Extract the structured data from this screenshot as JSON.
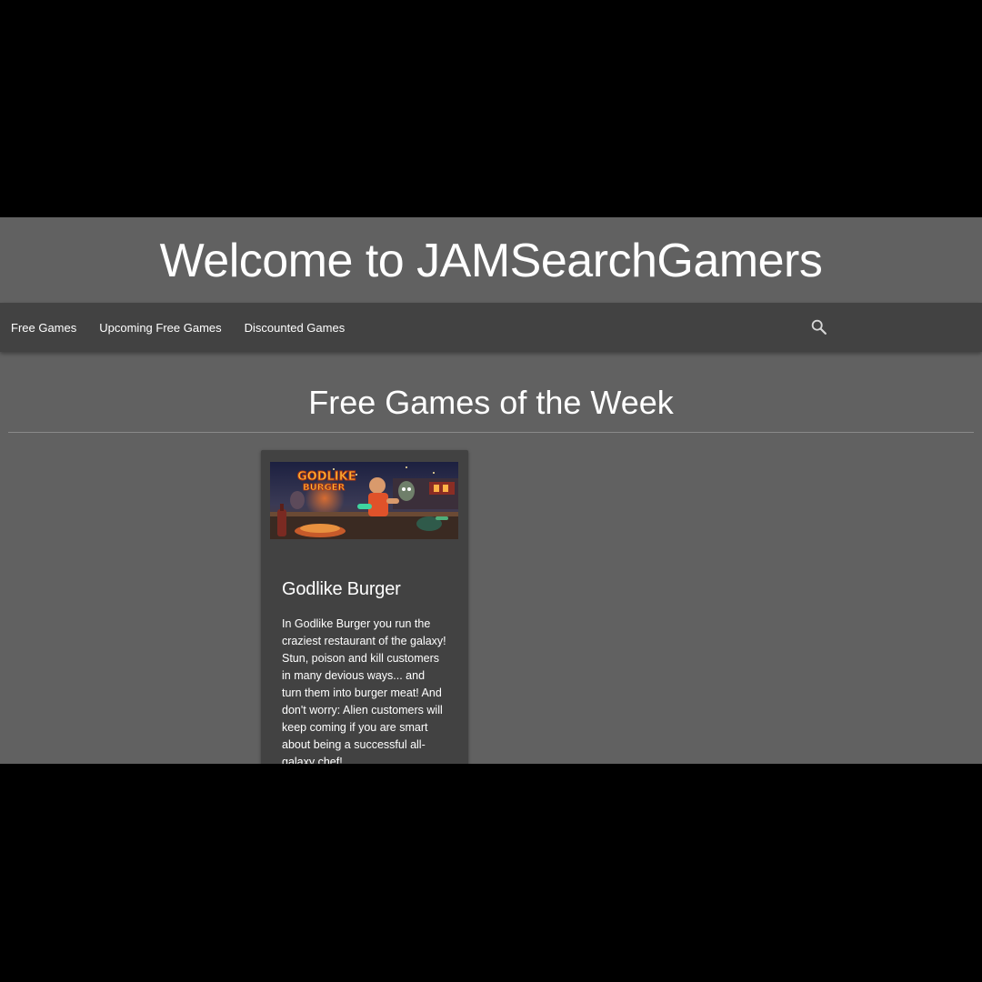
{
  "header": {
    "title": "Welcome to JAMSearchGamers"
  },
  "nav": {
    "items": [
      {
        "label": "Free Games"
      },
      {
        "label": "Upcoming Free Games"
      },
      {
        "label": "Discounted Games"
      }
    ],
    "search_icon": "search-icon"
  },
  "main": {
    "section_title": "Free Games of the Week",
    "games": [
      {
        "name": "Godlike Burger",
        "image_logo_text": "GODLIKE BURGER",
        "description": "In Godlike Burger you run the craziest restaurant of the galaxy! Stun, poison and kill customers in many devious ways... and turn them into burger meat! And don't worry: Alien customers will keep coming if you are smart about being a successful all-galaxy chef!"
      }
    ]
  },
  "colors": {
    "page_background": "#616161",
    "navbar_background": "#424242",
    "card_background": "#424242",
    "letterbox": "#000000",
    "text": "#ffffff"
  }
}
